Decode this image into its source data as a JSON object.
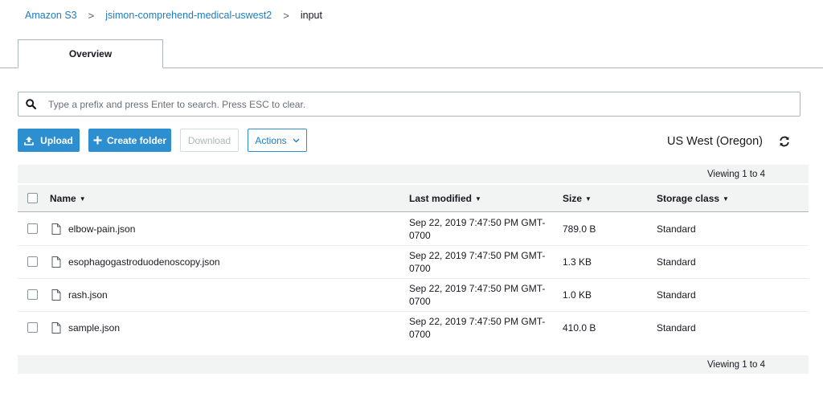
{
  "breadcrumb": {
    "root": "Amazon S3",
    "bucket": "jsimon-comprehend-medical-uswest2",
    "folder": "input",
    "separator": ">"
  },
  "tabs": [
    {
      "label": "Overview",
      "active": true
    }
  ],
  "search": {
    "placeholder": "Type a prefix and press Enter to search. Press ESC to clear.",
    "value": ""
  },
  "toolbar": {
    "upload_label": "Upload",
    "create_folder_label": "Create folder",
    "download_label": "Download",
    "actions_label": "Actions",
    "region": "US West (Oregon)"
  },
  "table": {
    "viewing_top": "Viewing 1 to 4",
    "viewing_bottom": "Viewing 1 to 4",
    "columns": {
      "name": "Name",
      "last_modified": "Last modified",
      "size": "Size",
      "storage_class": "Storage class"
    },
    "rows": [
      {
        "name": "elbow-pain.json",
        "modified_1": "Sep 22, 2019 7:47:50 PM GMT-",
        "modified_2": "0700",
        "size": "789.0 B",
        "storage": "Standard"
      },
      {
        "name": "esophagogastroduodenoscopy.json",
        "modified_1": "Sep 22, 2019 7:47:50 PM GMT-",
        "modified_2": "0700",
        "size": "1.3 KB",
        "storage": "Standard"
      },
      {
        "name": "rash.json",
        "modified_1": "Sep 22, 2019 7:47:50 PM GMT-",
        "modified_2": "0700",
        "size": "1.0 KB",
        "storage": "Standard"
      },
      {
        "name": "sample.json",
        "modified_1": "Sep 22, 2019 7:47:50 PM GMT-",
        "modified_2": "0700",
        "size": "410.0 B",
        "storage": "Standard"
      }
    ]
  },
  "icons": {
    "search": "search-icon",
    "upload": "upload-icon",
    "create_folder": "plus-icon",
    "actions": "chevron-down-icon",
    "refresh": "refresh-icon",
    "file": "file-icon"
  },
  "colors": {
    "primary": "#2d8ed0",
    "link": "#1f7bc1",
    "border": "#aab7b8",
    "header_bg": "#f2f3f3"
  }
}
